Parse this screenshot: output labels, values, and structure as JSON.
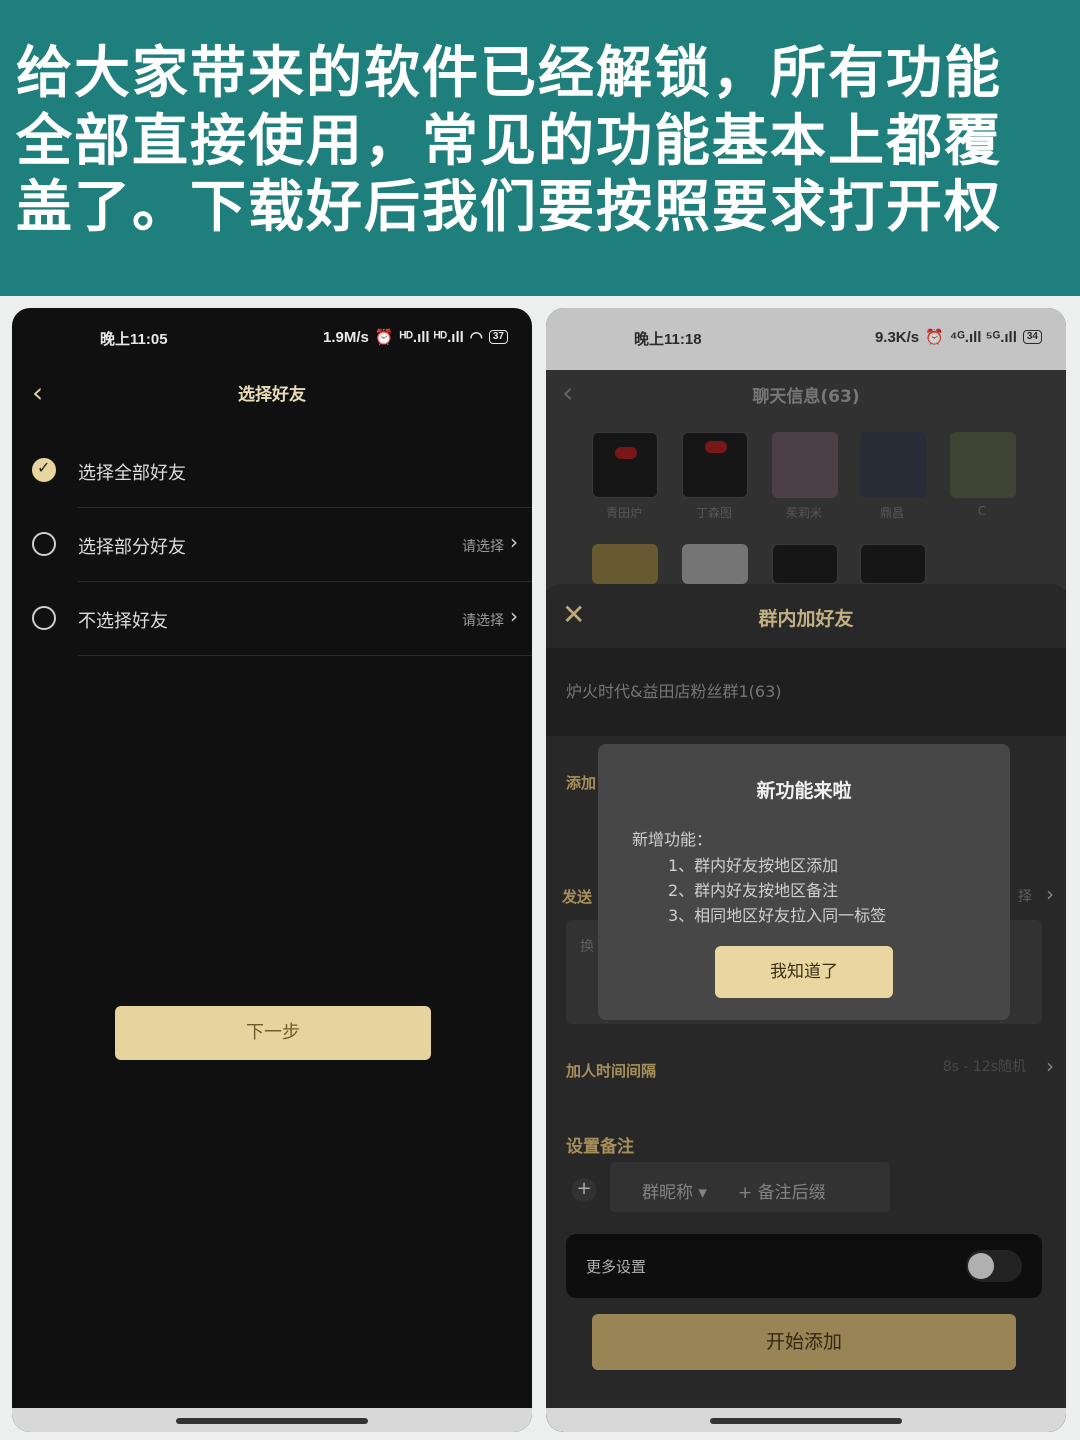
{
  "banner": {
    "line1": "给大家带来的软件已经解锁，所有功能",
    "line2": "全部直接使用，常见的功能基本上都覆",
    "line3": "盖了。下载好后我们要按照要求打开权"
  },
  "left_phone": {
    "status": {
      "time": "晚上11:05",
      "speed": "1.9M/s",
      "signal": "ᴴᴰ.ıll ᴴᴰ.ıll",
      "battery": "37"
    },
    "title": "选择好友",
    "options": [
      {
        "label": "选择全部好友",
        "checked": true,
        "pick": ""
      },
      {
        "label": "选择部分好友",
        "checked": false,
        "pick": "请选择"
      },
      {
        "label": "不选择好友",
        "checked": false,
        "pick": "请选择"
      }
    ],
    "next_button": "下一步"
  },
  "right_phone": {
    "status": {
      "time": "晚上11:18",
      "speed": "9.3K/s",
      "signal": "⁴ᴳ.ıll ⁵ᴳ.ıll",
      "battery": "34"
    },
    "title": "聊天信息(63)",
    "avatar_names": [
      "青田炉",
      "丁森图",
      "茱莉米",
      "鼎昌",
      "C"
    ],
    "sheet_title": "群内加好友",
    "group_name": "炉火时代&益田店粉丝群1(63)",
    "section_add": "添加",
    "section_send": "发送",
    "send_pick": "择",
    "msg_hint": "换",
    "interval_label": "加人时间间隔",
    "interval_value": "8s - 12s随机",
    "remark_label": "设置备注",
    "remark_chip1": "群昵称 ▾",
    "remark_chip2": "+ 备注后缀",
    "more_settings": "更多设置",
    "start_button": "开始添加",
    "dialog": {
      "title": "新功能来啦",
      "subtitle": "新增功能：",
      "items": [
        "1、群内好友按地区添加",
        "2、群内好友按地区备注",
        "3、相同地区好友拉入同一标签"
      ],
      "confirm": "我知道了"
    }
  },
  "colors": {
    "accent_gold": "#e6d39d",
    "banner_teal": "#1f7f7c"
  }
}
